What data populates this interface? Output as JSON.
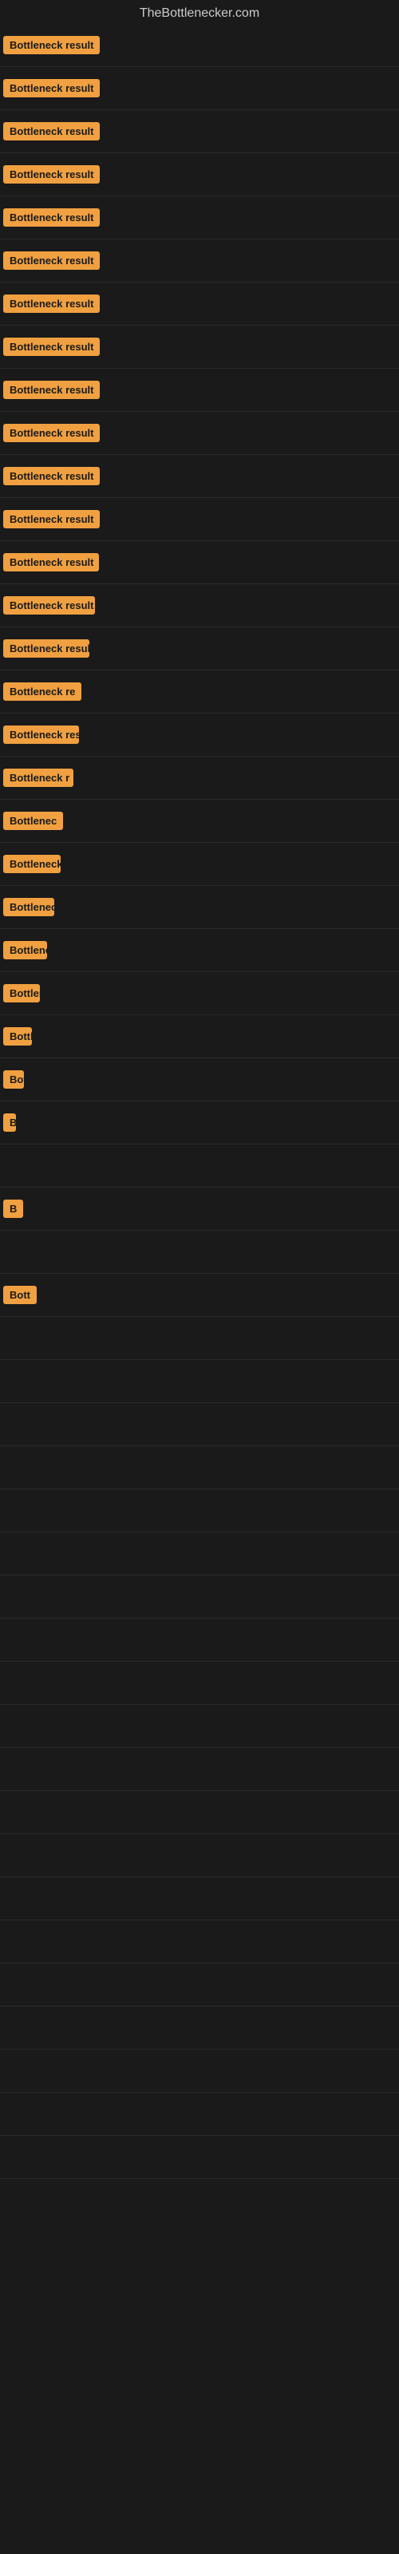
{
  "site": {
    "title": "TheBottlenecker.com"
  },
  "entries": [
    {
      "id": 1,
      "label": "Bottleneck result"
    },
    {
      "id": 2,
      "label": "Bottleneck result"
    },
    {
      "id": 3,
      "label": "Bottleneck result"
    },
    {
      "id": 4,
      "label": "Bottleneck result"
    },
    {
      "id": 5,
      "label": "Bottleneck result"
    },
    {
      "id": 6,
      "label": "Bottleneck result"
    },
    {
      "id": 7,
      "label": "Bottleneck result"
    },
    {
      "id": 8,
      "label": "Bottleneck result"
    },
    {
      "id": 9,
      "label": "Bottleneck result"
    },
    {
      "id": 10,
      "label": "Bottleneck result"
    },
    {
      "id": 11,
      "label": "Bottleneck result"
    },
    {
      "id": 12,
      "label": "Bottleneck result"
    },
    {
      "id": 13,
      "label": "Bottleneck result"
    },
    {
      "id": 14,
      "label": "Bottleneck result"
    },
    {
      "id": 15,
      "label": "Bottleneck result"
    },
    {
      "id": 16,
      "label": "Bottleneck re"
    },
    {
      "id": 17,
      "label": "Bottleneck result"
    },
    {
      "id": 18,
      "label": "Bottleneck r"
    },
    {
      "id": 19,
      "label": "Bottlenec"
    },
    {
      "id": 20,
      "label": "Bottleneck r"
    },
    {
      "id": 21,
      "label": "Bottleneck"
    },
    {
      "id": 22,
      "label": "Bottleneck res"
    },
    {
      "id": 23,
      "label": "Bottlens"
    },
    {
      "id": 24,
      "label": "Bottleneck"
    },
    {
      "id": 25,
      "label": "Bot"
    },
    {
      "id": 26,
      "label": "B"
    },
    {
      "id": 27,
      "label": ""
    },
    {
      "id": 28,
      "label": "B"
    },
    {
      "id": 29,
      "label": ""
    },
    {
      "id": 30,
      "label": "Bott"
    }
  ]
}
